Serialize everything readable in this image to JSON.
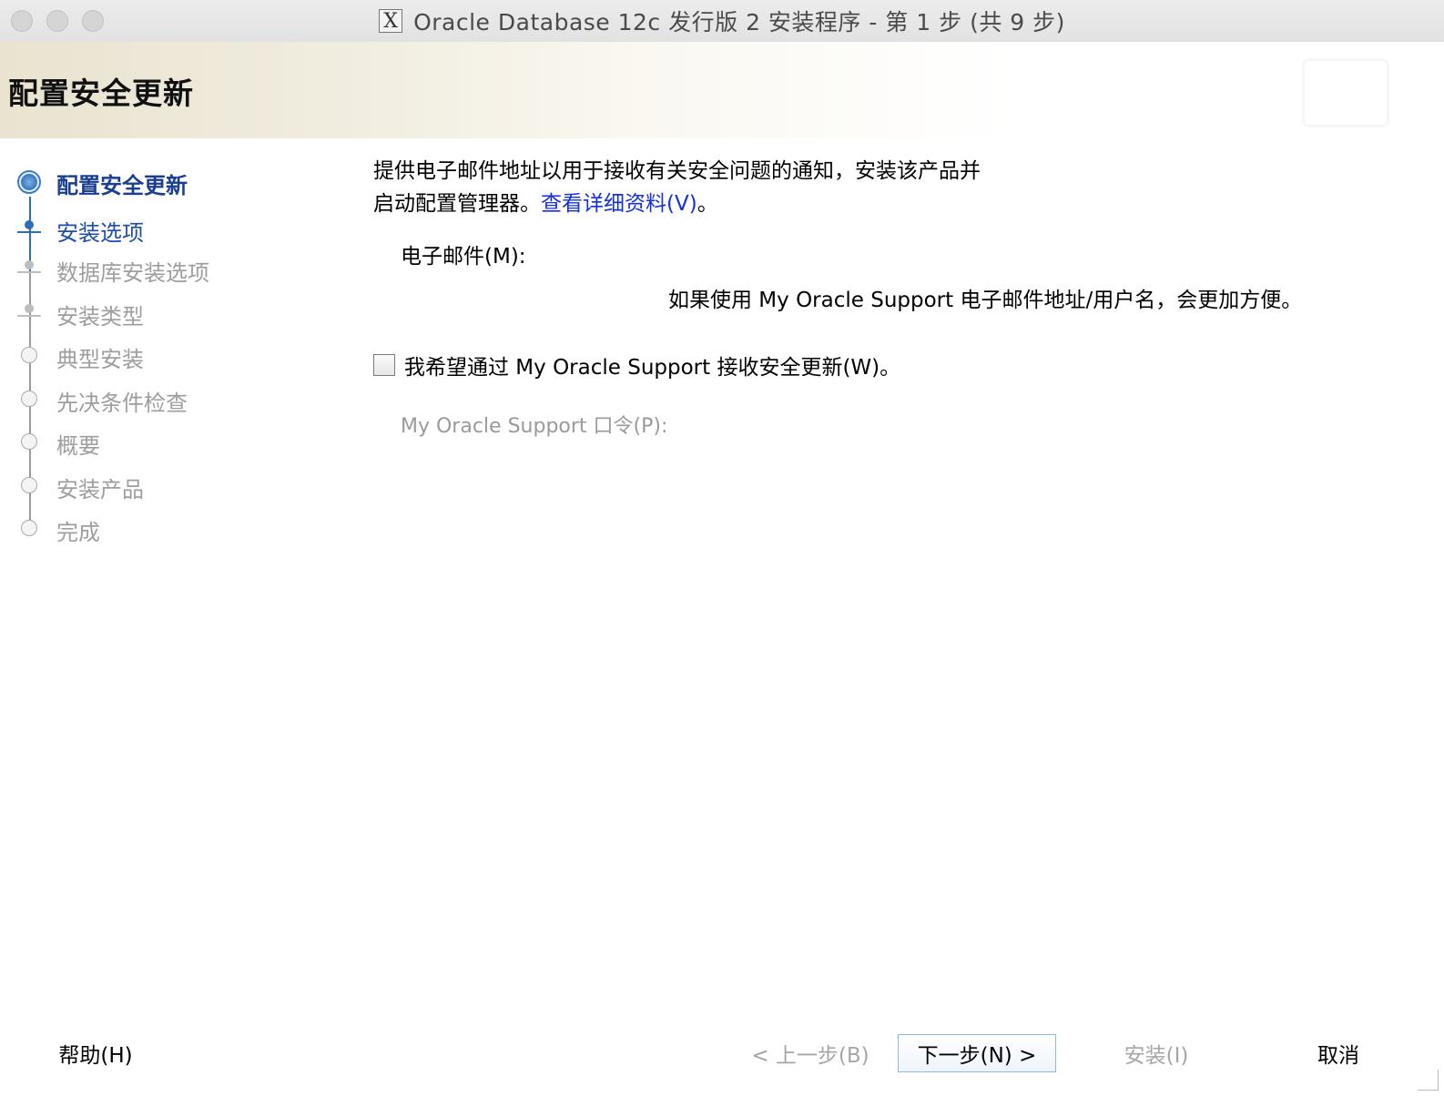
{
  "window": {
    "title": "Oracle Database 12c 发行版 2 安装程序 - 第 1 步 (共 9 步)",
    "app_icon": "x11-icon"
  },
  "header": {
    "title": "配置安全更新"
  },
  "steps": [
    {
      "label": "配置安全更新",
      "state": "current"
    },
    {
      "label": "安装选项",
      "state": "next"
    },
    {
      "label": "数据库安装选项",
      "state": "disabled"
    },
    {
      "label": "安装类型",
      "state": "disabled"
    },
    {
      "label": "典型安装",
      "state": "disabled"
    },
    {
      "label": "先决条件检查",
      "state": "disabled"
    },
    {
      "label": "概要",
      "state": "disabled"
    },
    {
      "label": "安装产品",
      "state": "disabled"
    },
    {
      "label": "完成",
      "state": "disabled"
    }
  ],
  "content": {
    "desc_line1": "提供电子邮件地址以用于接收有关安全问题的通知，安装该产品并",
    "desc_line2": "启动配置管理器。",
    "details_link": "查看详细资料(V)",
    "desc_end": "。",
    "email_label": "电子邮件(M):",
    "email_value": "",
    "email_hint": "如果使用 My Oracle Support 电子邮件地址/用户名，会更加方便。",
    "checkbox_label": "我希望通过 My Oracle Support 接收安全更新(W)。",
    "checkbox_checked": false,
    "password_label": "My Oracle Support 口令(P):",
    "password_value": ""
  },
  "buttons": {
    "help": "帮助(H)",
    "back": "< 上一步(B)",
    "next": "下一步(N) >",
    "install": "安装(I)",
    "cancel": "取消"
  }
}
